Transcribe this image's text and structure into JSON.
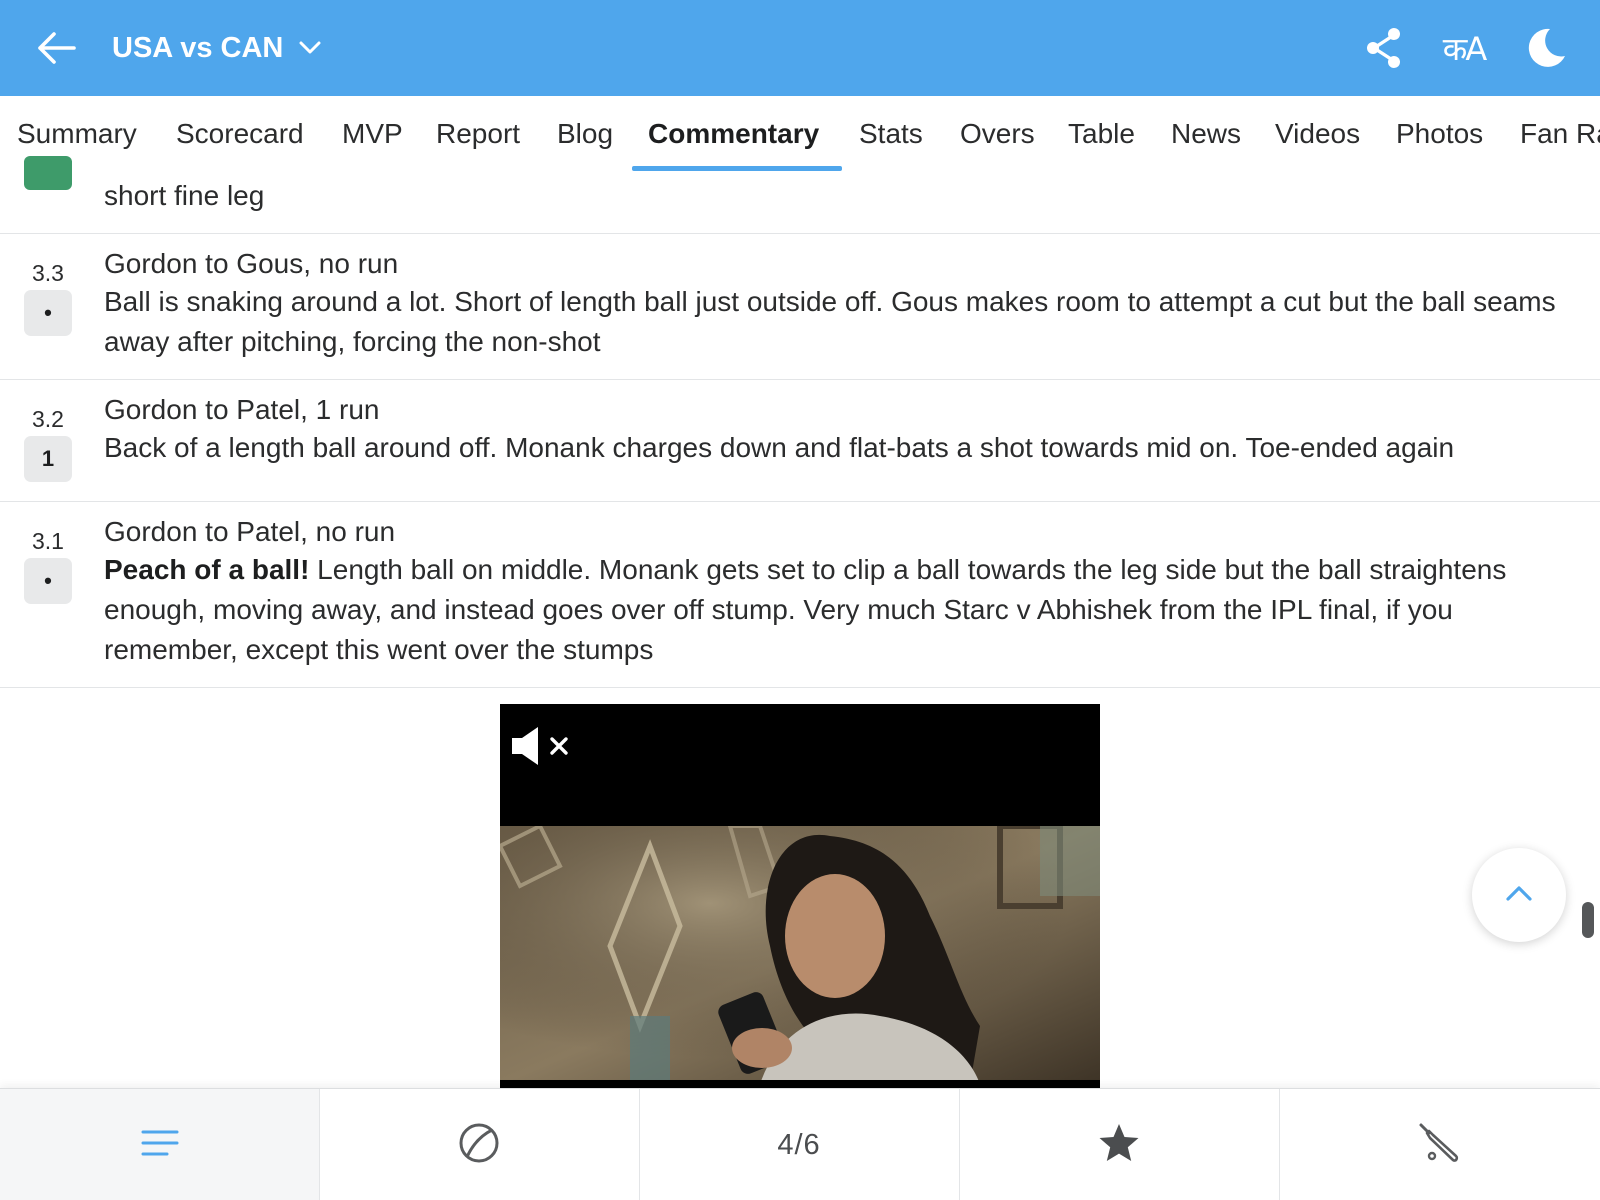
{
  "header": {
    "title": "USA vs CAN",
    "lang_label": "कA",
    "accent": "#4fa6ec"
  },
  "tabs": [
    {
      "label": "Summary"
    },
    {
      "label": "Scorecard"
    },
    {
      "label": "MVP"
    },
    {
      "label": "Report"
    },
    {
      "label": "Blog"
    },
    {
      "label": "Commentary",
      "active": true
    },
    {
      "label": "Stats"
    },
    {
      "label": "Overs"
    },
    {
      "label": "Table"
    },
    {
      "label": "News"
    },
    {
      "label": "Videos"
    },
    {
      "label": "Photos"
    },
    {
      "label": "Fan Ra"
    }
  ],
  "commentary": {
    "partial": {
      "text": "short fine leg",
      "badge_color": "#3e9b6a"
    },
    "balls": [
      {
        "over": "3.3",
        "badge": "•",
        "title": "Gordon to Gous, no run",
        "highlight": "",
        "text": "Ball is snaking around a lot. Short of length ball just outside off. Gous makes room to attempt a cut but the ball seams away after pitching, forcing the non-shot"
      },
      {
        "over": "3.2",
        "badge": "1",
        "title": "Gordon to Patel, 1 run",
        "highlight": "",
        "text": "Back of a length ball around off. Monank charges down and flat-bats a shot towards mid on. Toe-ended again"
      },
      {
        "over": "3.1",
        "badge": "•",
        "title": "Gordon to Patel, no run",
        "highlight": "Peach of a ball!",
        "text": " Length ball on middle. Monank gets set to clip a ball towards the leg side but the ball straightens enough, moving away, and instead goes over off stump. Very much Starc v Abhishek from the IPL final, if you remember, except this went over the stumps"
      }
    ]
  },
  "video_ad": {
    "mute_icon": "speaker-muted-icon"
  },
  "bottom_nav": {
    "items": [
      {
        "icon": "menu-lines-icon",
        "active": true
      },
      {
        "icon": "cricket-ball-icon"
      },
      {
        "label": "4/6"
      },
      {
        "icon": "star-icon"
      },
      {
        "icon": "cricket-bat-icon"
      }
    ]
  }
}
